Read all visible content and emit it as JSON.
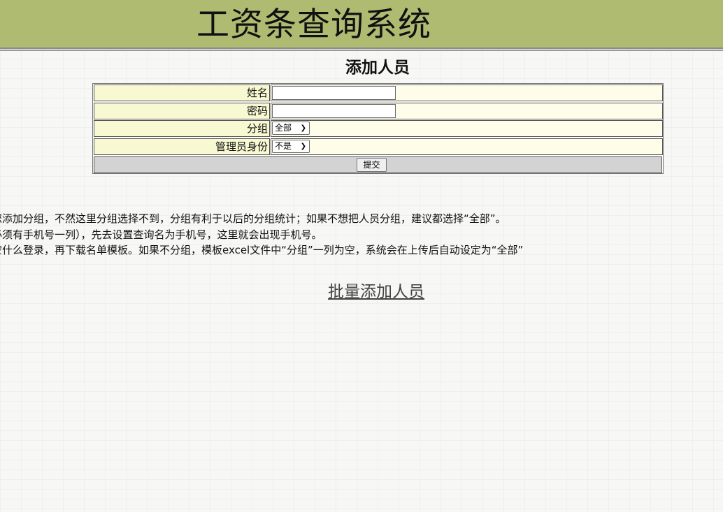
{
  "header": {
    "title": "工资条查询系统"
  },
  "page_title": "添加人员",
  "form": {
    "fields": [
      {
        "label": "姓名",
        "type": "text",
        "value": ""
      },
      {
        "label": "密码",
        "type": "text",
        "value": ""
      },
      {
        "label": "分组",
        "type": "select",
        "value": "全部"
      },
      {
        "label": "管理员身份",
        "type": "select",
        "value": "不是"
      }
    ],
    "submit_label": "提交"
  },
  "notes": [
    "您添加分组，不然这里分组选择不到，分组有利于以后的分组统计；如果不想把人员分组，建议都选择“全部”。",
    "必须有手机号一列），先去设置查询名为手机号，这里就会出现手机号。",
    "空什么登录，再下载名单模板。如果不分组，模板excel文件中“分组”一列为空，系统会在上传后自动设定为“全部”"
  ],
  "batch_link": "批量添加人员",
  "colors": {
    "header_bg": "#b0bb72",
    "label_bg": "#f8f8d2",
    "field_bg": "#fdfde9",
    "submit_row_bg": "#d3d3d3"
  }
}
